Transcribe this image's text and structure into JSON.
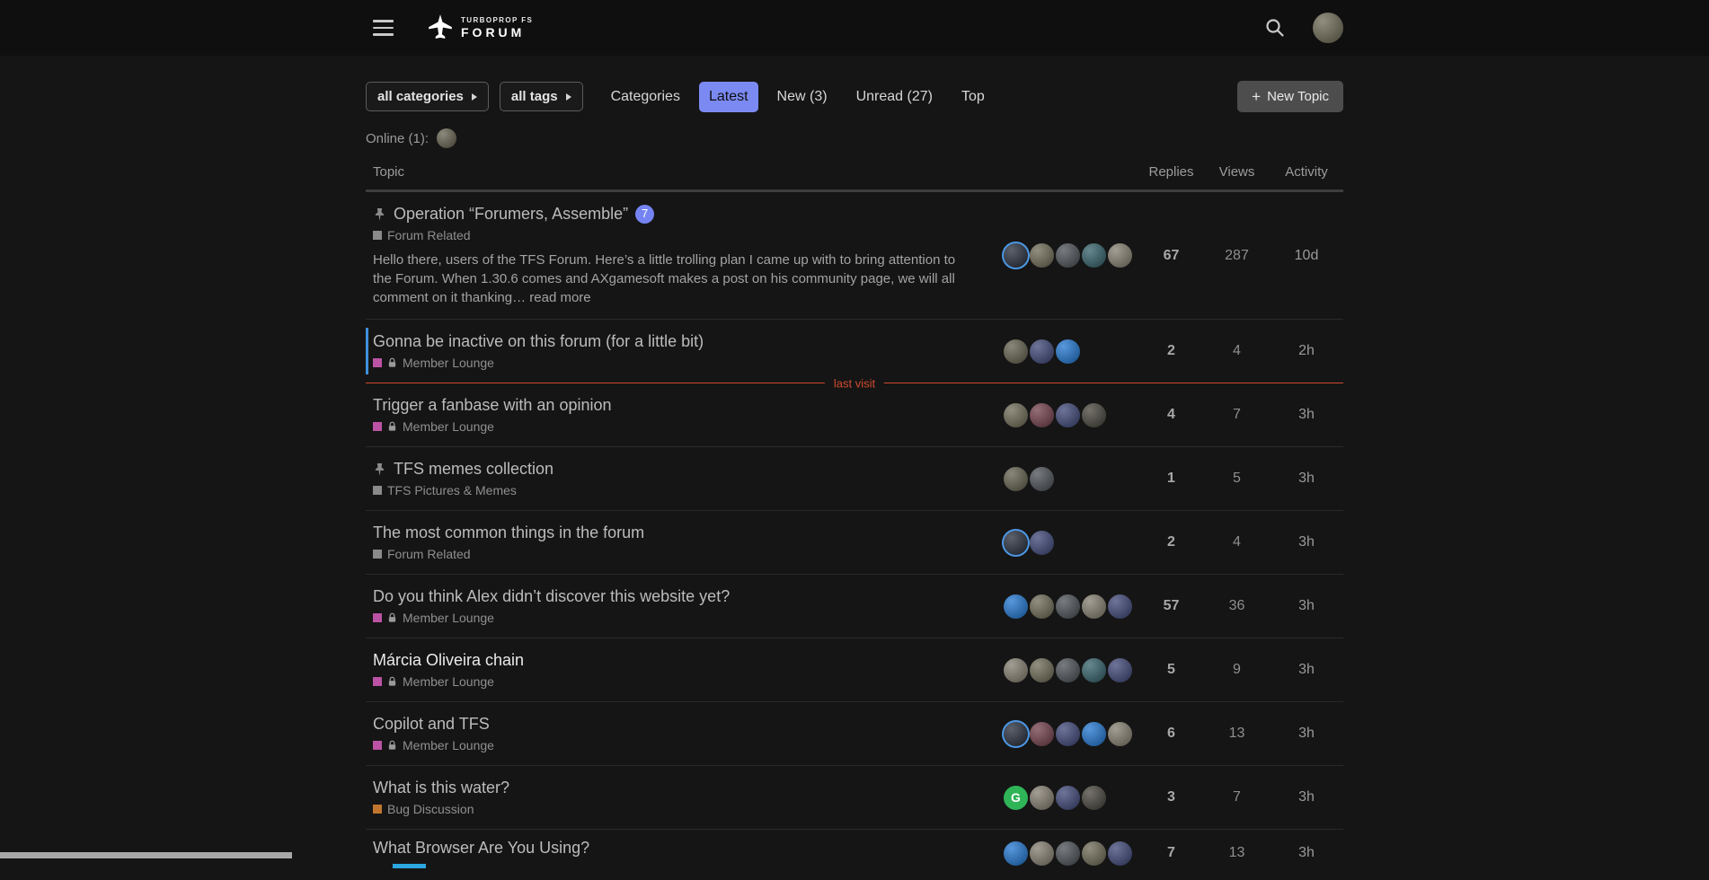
{
  "colors": {
    "page-bg": "#151515",
    "header-bg": "#0f0f0f",
    "accent": "#7b8af2",
    "new-topic-bg": "#4d4d4d",
    "unread-bar": "#3e8fdd",
    "last-visit": "#cf4a30",
    "avatar-ring": "#4c97e4",
    "partial-badge": "#2ba6df",
    "badge-bg": "#7584f2"
  },
  "header": {
    "logo_line1": "TURBOPROP FS",
    "logo_line2": "FORUM"
  },
  "filters": {
    "categories": "all categories",
    "tags": "all tags"
  },
  "nav": {
    "links": [
      {
        "label": "Categories",
        "active": false
      },
      {
        "label": "Latest",
        "active": true
      },
      {
        "label": "New (3)",
        "active": false
      },
      {
        "label": "Unread (27)",
        "active": false
      },
      {
        "label": "Top",
        "active": false
      }
    ],
    "new_topic": "New Topic"
  },
  "online": {
    "label": "Online (1):",
    "avatars": [
      {
        "color": "#6f6c5a"
      }
    ]
  },
  "user_avatar": {
    "color": "#76735f"
  },
  "table": {
    "topic": "Topic",
    "replies": "Replies",
    "views": "Views",
    "activity": "Activity"
  },
  "last_visit_label": "last visit",
  "topics": [
    {
      "title": "Operation “Forumers, Assemble”",
      "pinned": true,
      "badge": "7",
      "category": {
        "name": "Forum Related",
        "color": "#8a8a8a",
        "locked": false
      },
      "excerpt": "Hello there, users of the TFS Forum. Here’s a little trolling plan I came up with to bring attention to the Forum. When 1.30.6 comes and AXgamesoft makes a post on his community page, we will all comment on it thanking…",
      "read_more": "read more",
      "posters": [
        {
          "color": "#333a47",
          "ring": true
        },
        {
          "color": "#76735f"
        },
        {
          "color": "#565b60"
        },
        {
          "color": "#3f6a72"
        },
        {
          "color": "#8c8678"
        }
      ],
      "replies": "67",
      "views": "287",
      "activity": "10d"
    },
    {
      "title": "Gonna be inactive on this forum (for a little bit)",
      "unread": true,
      "category": {
        "name": "Member Lounge",
        "color": "#bb53a4",
        "locked": true
      },
      "posters": [
        {
          "color": "#6b6a58"
        },
        {
          "color": "#4a5280"
        },
        {
          "color": "#2e7ed3"
        }
      ],
      "replies": "2",
      "views": "4",
      "activity": "2h",
      "last_visit_after": true
    },
    {
      "title": "Trigger a fanbase with an opinion",
      "category": {
        "name": "Member Lounge",
        "color": "#bb53a4",
        "locked": true
      },
      "posters": [
        {
          "color": "#76735f"
        },
        {
          "color": "#7a4a55"
        },
        {
          "color": "#4a5280"
        },
        {
          "color": "#514f46"
        }
      ],
      "replies": "4",
      "views": "7",
      "activity": "3h"
    },
    {
      "title": "TFS memes collection",
      "pinned": true,
      "category": {
        "name": "TFS Pictures & Memes",
        "color": "#8a8a8a",
        "locked": false
      },
      "posters": [
        {
          "color": "#6b6a58"
        },
        {
          "color": "#565b60"
        }
      ],
      "replies": "1",
      "views": "5",
      "activity": "3h"
    },
    {
      "title": "The most common things in the forum",
      "category": {
        "name": "Forum Related",
        "color": "#8a8a8a",
        "locked": false
      },
      "posters": [
        {
          "color": "#333a47",
          "ring": true
        },
        {
          "color": "#4a5280"
        }
      ],
      "replies": "2",
      "views": "4",
      "activity": "3h"
    },
    {
      "title": "Do you think Alex didn’t discover this website yet?",
      "category": {
        "name": "Member Lounge",
        "color": "#bb53a4",
        "locked": true
      },
      "posters": [
        {
          "color": "#2e7ed3"
        },
        {
          "color": "#76735f"
        },
        {
          "color": "#565b60"
        },
        {
          "color": "#8c8678"
        },
        {
          "color": "#4a5280"
        }
      ],
      "replies": "57",
      "views": "36",
      "activity": "3h"
    },
    {
      "title": "Márcia Oliveira chain",
      "bright": true,
      "category": {
        "name": "Member Lounge",
        "color": "#bb53a4",
        "locked": true
      },
      "posters": [
        {
          "color": "#8c8678"
        },
        {
          "color": "#76735f"
        },
        {
          "color": "#565b60"
        },
        {
          "color": "#3f6a72"
        },
        {
          "color": "#4a5280"
        }
      ],
      "replies": "5",
      "views": "9",
      "activity": "3h"
    },
    {
      "title": "Copilot and TFS",
      "category": {
        "name": "Member Lounge",
        "color": "#bb53a4",
        "locked": true
      },
      "posters": [
        {
          "color": "#333a47",
          "ring": true
        },
        {
          "color": "#7a4a55"
        },
        {
          "color": "#4a5280"
        },
        {
          "color": "#2e7ed3"
        },
        {
          "color": "#8c8678"
        }
      ],
      "replies": "6",
      "views": "13",
      "activity": "3h"
    },
    {
      "title": "What is this water?",
      "category": {
        "name": "Bug Discussion",
        "color": "#c0762f",
        "locked": false
      },
      "posters": [
        {
          "color": "#2fb457",
          "letter": "G"
        },
        {
          "color": "#8c8678"
        },
        {
          "color": "#4a5280"
        },
        {
          "color": "#514f46"
        }
      ],
      "replies": "3",
      "views": "7",
      "activity": "3h"
    },
    {
      "title": "What Browser Are You Using?",
      "partial": true,
      "posters": [
        {
          "color": "#2e7ed3"
        },
        {
          "color": "#8c8678"
        },
        {
          "color": "#565b60"
        },
        {
          "color": "#76735f"
        },
        {
          "color": "#4a5280"
        }
      ],
      "replies": "7",
      "views": "13",
      "activity": "3h"
    }
  ]
}
